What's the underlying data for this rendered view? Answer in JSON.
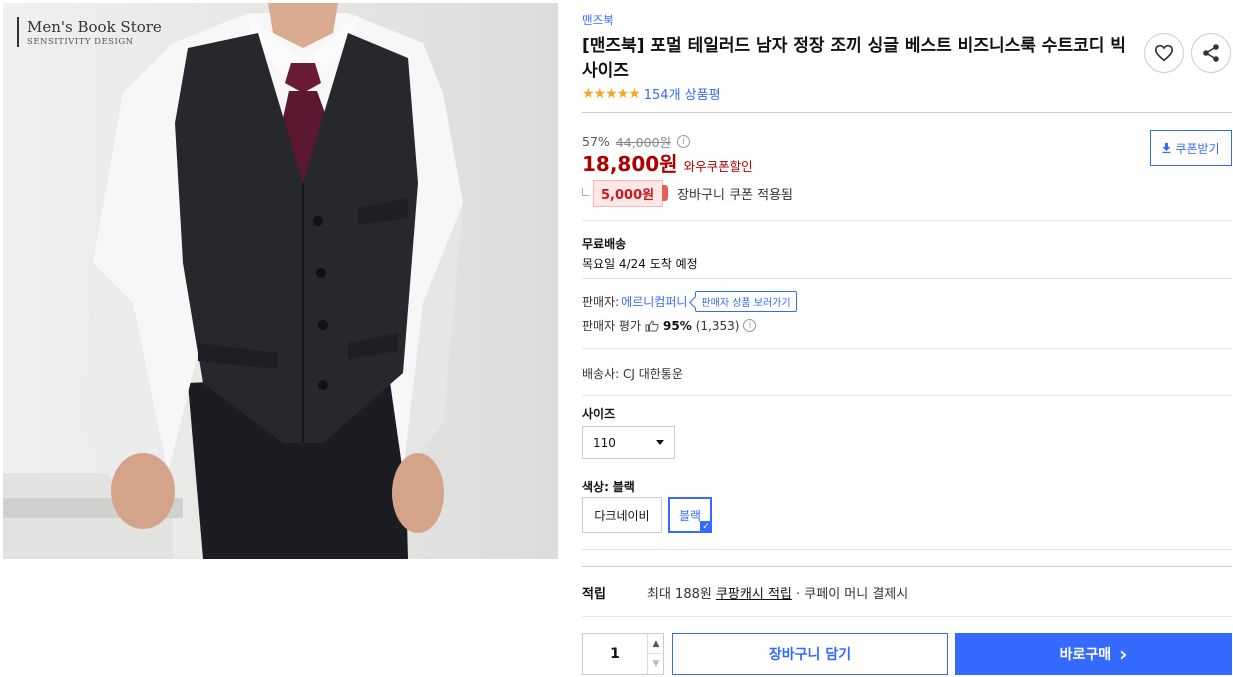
{
  "image": {
    "watermark_title": "Men's Book Store",
    "watermark_subtitle": "SENSITIVITY DESIGN"
  },
  "product": {
    "brand": "맨즈북",
    "title": "[맨즈북] 포멀 테일러드 남자 정장 조끼 싱글 베스트 비즈니스룩 수트코디 빅사이즈",
    "stars": "★★★★★",
    "rating": 4.5,
    "review_count_label": "154개 상품평",
    "wishlist_icon": "heart-icon",
    "share_icon": "share-icon"
  },
  "price": {
    "discount_rate": "57%",
    "original_price": "44,000원",
    "info_icon": "i",
    "sale_price": "18,800원",
    "wow_label": "와우쿠폰할인",
    "coupon_button": "쿠폰받기",
    "cart_coupon_amount": "5,000원",
    "cart_coupon_text": "장바구니 쿠폰 적용됨"
  },
  "shipping": {
    "label": "무료배송",
    "arrival": "목요일 4/24 도착 예정",
    "courier": "배송사: CJ 대한통운"
  },
  "seller": {
    "label": "판매자:",
    "name": "에르니컴퍼니",
    "products_tooltip": "판매자 상품 보러가기",
    "eval_label": "판매자 평가",
    "eval_percent": "95%",
    "eval_count": "(1,353)"
  },
  "options": {
    "size_label": "사이즈",
    "size_selected": "110",
    "color_label": "색상:",
    "color_selected": "블랙",
    "colors": [
      "다크네이비",
      "블랙"
    ]
  },
  "points": {
    "label": "적립",
    "prefix": "최대 188원 ",
    "link": "쿠팡캐시 적립",
    "suffix": " · 쿠페이 머니 결제시"
  },
  "purchase": {
    "quantity": "1",
    "cart_button": "장바구니 담기",
    "buy_button": "바로구매",
    "buy_chevron": "›"
  },
  "colors": {
    "accent": "#346aff",
    "price_red": "#ae0000",
    "star": "#f5a623"
  }
}
